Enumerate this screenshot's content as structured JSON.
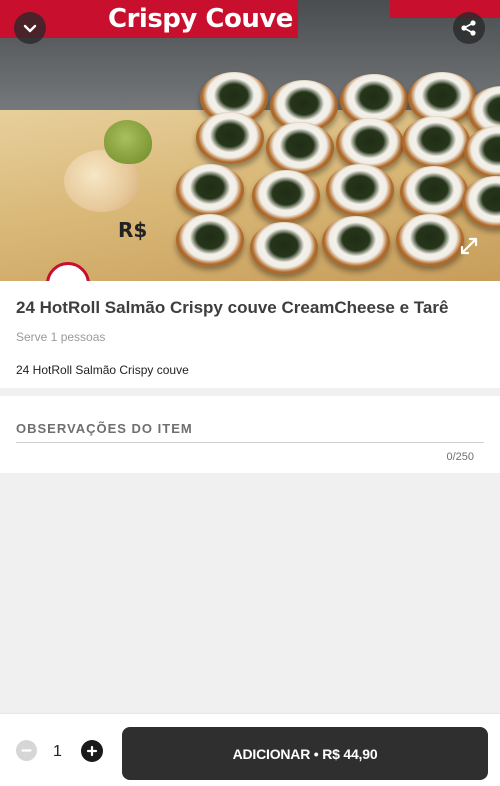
{
  "hero": {
    "banner_text": "Crispy Couve",
    "price_tag": "R$",
    "icons": {
      "collapse": "chevron-down-icon",
      "share": "share-icon",
      "expand": "expand-icon"
    }
  },
  "item": {
    "title": "24 HotRoll Salmão Crispy couve CreamCheese e Tarê",
    "serves": "Serve 1 pessoas",
    "description": "24 HotRoll Salmão Crispy couve"
  },
  "observations": {
    "label": "OBSERVAÇÕES DO ITEM",
    "counter": "0/250",
    "value": ""
  },
  "cart": {
    "quantity": "1",
    "add_label": "ADICIONAR • R$ 44,90"
  },
  "colors": {
    "brand_red": "#c8102e",
    "button_dark": "#2f2f2f"
  }
}
